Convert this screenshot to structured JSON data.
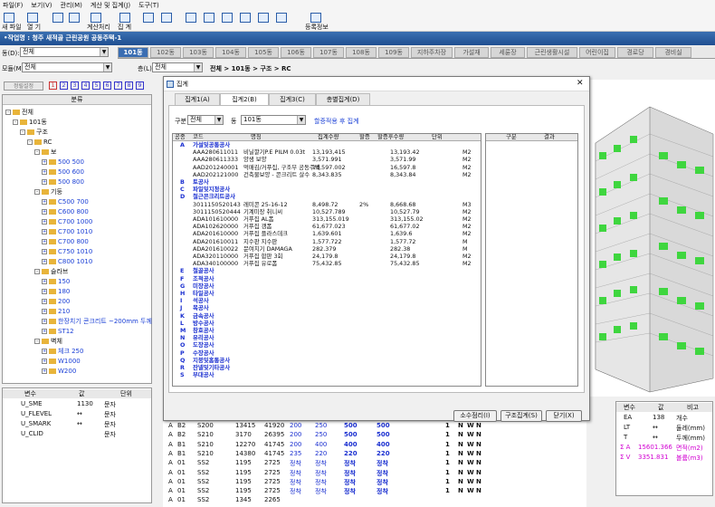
{
  "menu": [
    "파일(F)",
    "보기(V)",
    "관리(M)",
    "계산 및 집계(J)",
    "도구(T)"
  ],
  "toolbar": {
    "items": [
      "새 파일",
      "열 기",
      "",
      "",
      "",
      "계산처리",
      "집 계",
      "",
      "",
      "",
      "",
      "",
      "",
      "",
      "등록정보"
    ]
  },
  "window_title": "•작업명 : 청주 새적골 근린공원 공동주택-1",
  "top": {
    "combo_label": "동(D):",
    "combo_value": "전체",
    "tree_label": "모듈(M):",
    "tree_value": "전체",
    "floor_label": "층(L):",
    "floor_value": "전체",
    "breadcrumb": "전체 > 101동 > 구조 > RC"
  },
  "building_tabs": [
    "101동",
    "102동",
    "103동",
    "104동",
    "105동",
    "106동",
    "107동",
    "108동",
    "109동",
    "지하주차장",
    "가설재",
    "세륜장",
    "근린생활시설",
    "어린이집",
    "경로당",
    "경비실"
  ],
  "left_toolbar": {
    "left": "정릴설정",
    "nums": [
      "1",
      "2",
      "3",
      "4",
      "5",
      "6",
      "7",
      "8",
      "9"
    ],
    "header": "분류"
  },
  "tree": [
    {
      "label": "전체",
      "level": 0,
      "pm": "-"
    },
    {
      "label": "101동",
      "level": 1,
      "pm": "-"
    },
    {
      "label": "구조",
      "level": 2,
      "pm": "-"
    },
    {
      "label": "RC",
      "level": 3,
      "pm": "-"
    },
    {
      "label": "보",
      "level": 4,
      "pm": "-"
    },
    {
      "label": "500 500",
      "level": 5,
      "blue": true
    },
    {
      "label": "500 600",
      "level": 5,
      "blue": true
    },
    {
      "label": "500 800",
      "level": 5,
      "blue": true
    },
    {
      "label": "기둥",
      "level": 4,
      "pm": "-"
    },
    {
      "label": "C500 700",
      "level": 5,
      "blue": true
    },
    {
      "label": "C600 800",
      "level": 5,
      "blue": true
    },
    {
      "label": "C700 1000",
      "level": 5,
      "blue": true
    },
    {
      "label": "C700 1010",
      "level": 5,
      "blue": true
    },
    {
      "label": "C700 800",
      "level": 5,
      "blue": true
    },
    {
      "label": "C750 1010",
      "level": 5,
      "blue": true
    },
    {
      "label": "C800 1010",
      "level": 5,
      "blue": true
    },
    {
      "label": "슬라브",
      "level": 4,
      "pm": "-"
    },
    {
      "label": "150",
      "level": 5,
      "blue": true
    },
    {
      "label": "180",
      "level": 5,
      "blue": true
    },
    {
      "label": "200",
      "level": 5,
      "blue": true
    },
    {
      "label": "210",
      "level": 5,
      "blue": true
    },
    {
      "label": "한장치기 콘크리트 ~200mm 두께",
      "level": 5,
      "blue": true
    },
    {
      "label": "ST12",
      "level": 5,
      "blue": true
    },
    {
      "label": "벽체",
      "level": 4,
      "pm": "-"
    },
    {
      "label": "체크 250",
      "level": 5,
      "blue": true
    },
    {
      "label": "W1000",
      "level": 5,
      "blue": true
    },
    {
      "label": "W200",
      "level": 5,
      "blue": true
    }
  ],
  "varpanel": {
    "headers": [
      "변수",
      "값",
      "단위"
    ],
    "rows": [
      [
        "U_SME",
        "1130",
        "문자"
      ],
      [
        "U_FLEVEL",
        "↔",
        "문자"
      ],
      [
        "U_SMARK",
        "↔",
        "문자"
      ],
      [
        "U_CLID",
        "",
        "문자"
      ]
    ]
  },
  "dialog": {
    "title": "집계",
    "tabs": [
      "집계1(A)",
      "집계2(B)",
      "집계3(C)",
      "총별집계(D)"
    ],
    "filter": {
      "gubun_label": "구분",
      "gubun_value": "전체",
      "dong_label": "동",
      "dong_value": "101동",
      "link": "할증적용 후 집계"
    },
    "grid_headers": [
      "공종",
      "코드",
      "명칭",
      "집계수량",
      "할증",
      "할증후수량",
      "단위"
    ],
    "rows": [
      {
        "c": "A",
        "code": "가설및공통공사",
        "name": "",
        "q": "",
        "h": "",
        "qa": "",
        "u": "",
        "grp": true
      },
      {
        "c": "",
        "code": "AAA280611011",
        "name": "비닐깔기P.E PILM  0.03t",
        "q": "13,193,415",
        "h": "",
        "qa": "13,193.42",
        "u": "M2"
      },
      {
        "c": "",
        "code": "AAA280611333",
        "name": "양생 보양",
        "q": "3,571.991",
        "h": "",
        "qa": "3,571.99",
        "u": "M2"
      },
      {
        "c": "",
        "code": "AAD201240001",
        "name": "먹매김/거푸집, 구조부 공동주택",
        "q": "16,597.002",
        "h": "",
        "qa": "16,597.8",
        "u": "M2"
      },
      {
        "c": "",
        "code": "AAD202121000",
        "name": "건축물보양 - 콘크리트 살수",
        "q": "8,343.835",
        "h": "",
        "qa": "8,343.84",
        "u": "M2"
      },
      {
        "c": "B",
        "code": "토공사",
        "name": "",
        "q": "",
        "h": "",
        "qa": "",
        "u": "",
        "grp": true
      },
      {
        "c": "C",
        "code": "파일및지정공사",
        "name": "",
        "q": "",
        "h": "",
        "qa": "",
        "u": "",
        "grp": true
      },
      {
        "c": "D",
        "code": "철근콘크리트공사",
        "name": "",
        "q": "",
        "h": "",
        "qa": "",
        "u": "",
        "grp": true
      },
      {
        "c": "",
        "code": "3011150520143",
        "name": "레미콘 25-16-12",
        "q": "8,498.72",
        "h": "2%",
        "qa": "8,668.68",
        "u": "M3"
      },
      {
        "c": "",
        "code": "3011150520444",
        "name": "기계미장 취니씨",
        "q": "10,527.789",
        "h": "",
        "qa": "10,527.79",
        "u": "M2"
      },
      {
        "c": "",
        "code": "ADA101610000",
        "name": "거푸집 AL폼",
        "q": "313,155.019",
        "h": "",
        "qa": "313,155.02",
        "u": "M2"
      },
      {
        "c": "",
        "code": "ADA102620000",
        "name": "거푸집 갱폼",
        "q": "61,677.023",
        "h": "",
        "qa": "61,677.02",
        "u": "M2"
      },
      {
        "c": "",
        "code": "ADA201610000",
        "name": "거푸집 플라스데크",
        "q": "1,639.601",
        "h": "",
        "qa": "1,639.6",
        "u": "M2"
      },
      {
        "c": "",
        "code": "ADA201610011",
        "name": "지수판 지수판",
        "q": "1,577.722",
        "h": "",
        "qa": "1,577.72",
        "u": "M"
      },
      {
        "c": "",
        "code": "ADA201610022",
        "name": "문여치기 DAMAGA",
        "q": "282.379",
        "h": "",
        "qa": "282.38",
        "u": "M"
      },
      {
        "c": "",
        "code": "ADA320110000",
        "name": "거푸집 합판 3회",
        "q": "24,179.8",
        "h": "",
        "qa": "24,179.8",
        "u": "M2"
      },
      {
        "c": "",
        "code": "ADA340100000",
        "name": "거푸집 유로폼",
        "q": "75,432.85",
        "h": "",
        "qa": "75,432.85",
        "u": "M2"
      },
      {
        "c": "E",
        "code": "철골공사",
        "name": "",
        "grp": true
      },
      {
        "c": "F",
        "code": "조적공사",
        "name": "",
        "grp": true
      },
      {
        "c": "G",
        "code": "미장공사",
        "name": "",
        "grp": true
      },
      {
        "c": "H",
        "code": "타일공사",
        "name": "",
        "grp": true
      },
      {
        "c": "I",
        "code": "석공사",
        "name": "",
        "grp": true
      },
      {
        "c": "J",
        "code": "목공사",
        "name": "",
        "grp": true
      },
      {
        "c": "K",
        "code": "금속공사",
        "name": "",
        "grp": true
      },
      {
        "c": "L",
        "code": "방수공사",
        "name": "",
        "grp": true
      },
      {
        "c": "M",
        "code": "창호공사",
        "name": "",
        "grp": true
      },
      {
        "c": "N",
        "code": "유리공사",
        "name": "",
        "grp": true
      },
      {
        "c": "O",
        "code": "도장공사",
        "name": "",
        "grp": true
      },
      {
        "c": "P",
        "code": "수장공사",
        "name": "",
        "grp": true
      },
      {
        "c": "Q",
        "code": "지붕및홈통공사",
        "name": "",
        "grp": true
      },
      {
        "c": "R",
        "code": "잔넬및기타공사",
        "name": "",
        "grp": true
      },
      {
        "c": "S",
        "code": "부대공사",
        "name": "",
        "grp": true
      }
    ],
    "side_headers": [
      "구분",
      "결과"
    ],
    "buttons": [
      "소수점리(I)",
      "구조집계(S)",
      "닫기(X)"
    ]
  },
  "bottom_rows": [
    [
      "A",
      "B2",
      "S200",
      "13415",
      "41920",
      "200",
      "250",
      "500",
      "500",
      "1",
      "N",
      "W",
      "N"
    ],
    [
      "A",
      "B2",
      "S210",
      "3170",
      "26395",
      "200",
      "250",
      "500",
      "500",
      "1",
      "N",
      "W",
      "N"
    ],
    [
      "A",
      "B1",
      "S210",
      "12270",
      "41745",
      "200",
      "400",
      "400",
      "400",
      "1",
      "N",
      "W",
      "N"
    ],
    [
      "A",
      "B1",
      "S210",
      "14380",
      "41745",
      "235",
      "220",
      "220",
      "220",
      "1",
      "N",
      "W",
      "N"
    ],
    [
      "A",
      "01",
      "SS2",
      "1195",
      "2725",
      "정착",
      "정착",
      "정착",
      "정착",
      "1",
      "N",
      "W",
      "N"
    ],
    [
      "A",
      "01",
      "SS2",
      "1195",
      "2725",
      "정착",
      "정착",
      "정착",
      "정착",
      "1",
      "N",
      "W",
      "N"
    ],
    [
      "A",
      "01",
      "SS2",
      "1195",
      "2725",
      "정착",
      "정착",
      "정착",
      "정착",
      "1",
      "N",
      "W",
      "N"
    ],
    [
      "A",
      "01",
      "SS2",
      "1195",
      "2725",
      "정착",
      "정착",
      "정착",
      "정착",
      "1",
      "N",
      "W",
      "N"
    ],
    [
      "A",
      "01",
      "SS2",
      "1345",
      "2265",
      "",
      "",
      "",
      "",
      "",
      "",
      "",
      ""
    ]
  ],
  "rightvars": {
    "headers": [
      "변수",
      "값",
      "비고"
    ],
    "rows": [
      [
        "EA",
        "138",
        "개수"
      ],
      [
        "LT",
        "↔",
        "둘레(mm)"
      ],
      [
        "T",
        "↔",
        "두께(mm)"
      ],
      [
        "Σ A",
        "15601.366",
        "면적(m2)"
      ],
      [
        "Σ V",
        "3351.831",
        "볼륨(m3)"
      ]
    ]
  }
}
